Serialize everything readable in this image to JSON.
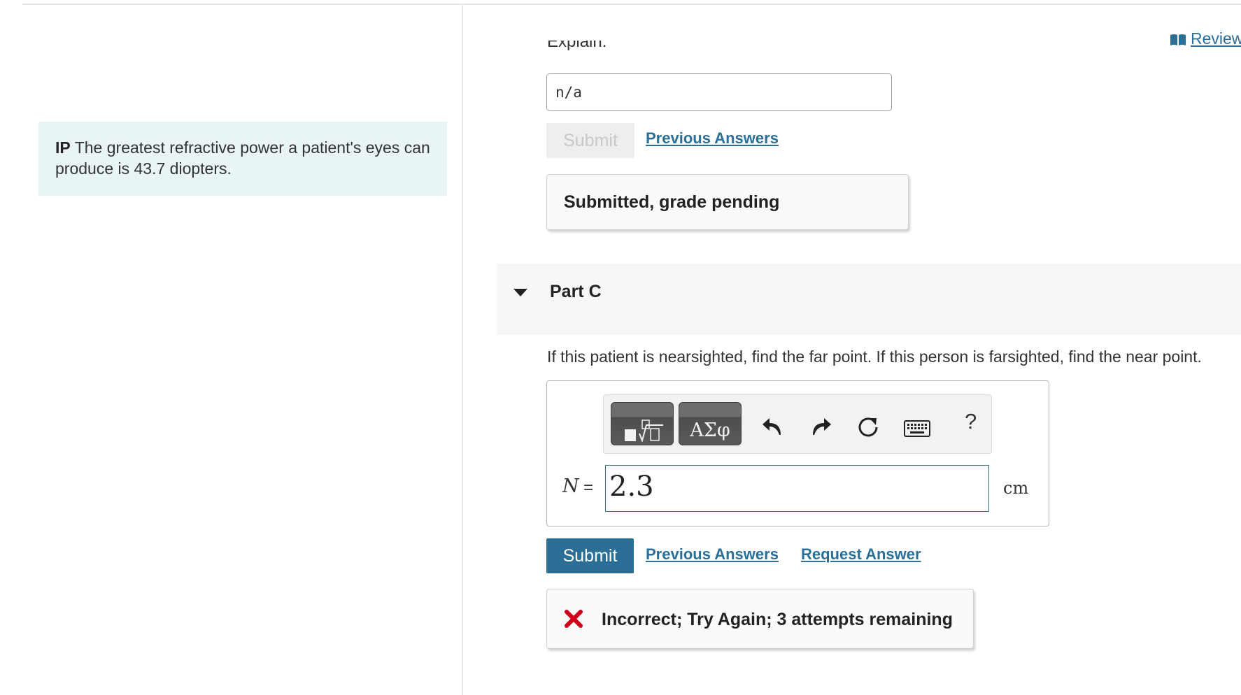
{
  "intro": {
    "prefix": "IP",
    "text": "The greatest refractive power a patient's eyes can produce is 43.7 diopters."
  },
  "review_link": "Review",
  "part_b": {
    "explain_label": "Explain:",
    "answer_value": "n/a",
    "submit_label": "Submit",
    "previous_answers_label": "Previous Answers",
    "feedback": "Submitted, grade pending"
  },
  "part_c": {
    "title": "Part C",
    "question": "If this patient is nearsighted, find the far point. If this person is farsighted, find the near point.",
    "toolbar": {
      "greek_label": "ΑΣφ",
      "help_label": "?"
    },
    "variable": "N",
    "equals": "=",
    "answer_value": "2.3",
    "unit": "cm",
    "submit_label": "Submit",
    "previous_answers_label": "Previous Answers",
    "request_answer_label": "Request Answer",
    "feedback": "Incorrect; Try Again; 3 attempts remaining"
  },
  "colors": {
    "accent": "#2b6e96",
    "link": "#2a6f97",
    "intro_bg": "#e8f4f5",
    "error": "#d0021b"
  }
}
